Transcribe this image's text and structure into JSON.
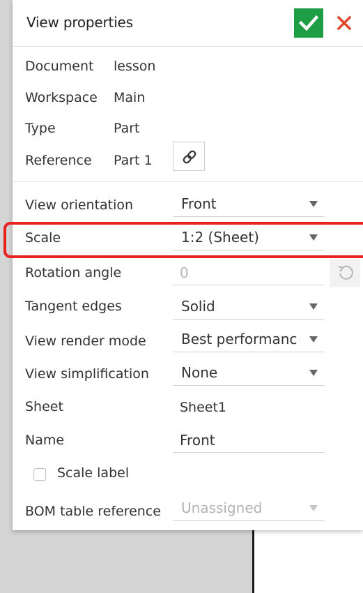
{
  "dialog": {
    "title": "View properties"
  },
  "info": [
    {
      "label": "Document",
      "value": "lesson"
    },
    {
      "label": "Workspace",
      "value": "Main"
    },
    {
      "label": "Type",
      "value": "Part"
    },
    {
      "label": "Reference",
      "value": "Part 1"
    }
  ],
  "properties": {
    "view_orientation": {
      "label": "View orientation",
      "value": "Front"
    },
    "scale": {
      "label": "Scale",
      "value": "1:2 (Sheet)"
    },
    "rotation_angle": {
      "label": "Rotation angle",
      "value": "0"
    },
    "tangent_edges": {
      "label": "Tangent edges",
      "value": "Solid"
    },
    "view_render_mode": {
      "label": "View render mode",
      "value": "Best performanc"
    },
    "view_simplification": {
      "label": "View simplification",
      "value": "None"
    },
    "sheet": {
      "label": "Sheet",
      "value": "Sheet1"
    },
    "name": {
      "label": "Name",
      "value": "Front"
    },
    "scale_label": {
      "label": "Scale label",
      "checked": false
    },
    "bom_table_reference": {
      "label": "BOM table reference",
      "value": "Unassigned"
    }
  },
  "colors": {
    "accept": "#1e9e44",
    "cancel": "#e0452a",
    "highlight": "#e8211f"
  },
  "icons": {
    "accept": "check-icon",
    "cancel": "close-icon",
    "reference": "link-icon",
    "reset": "reset-icon"
  }
}
